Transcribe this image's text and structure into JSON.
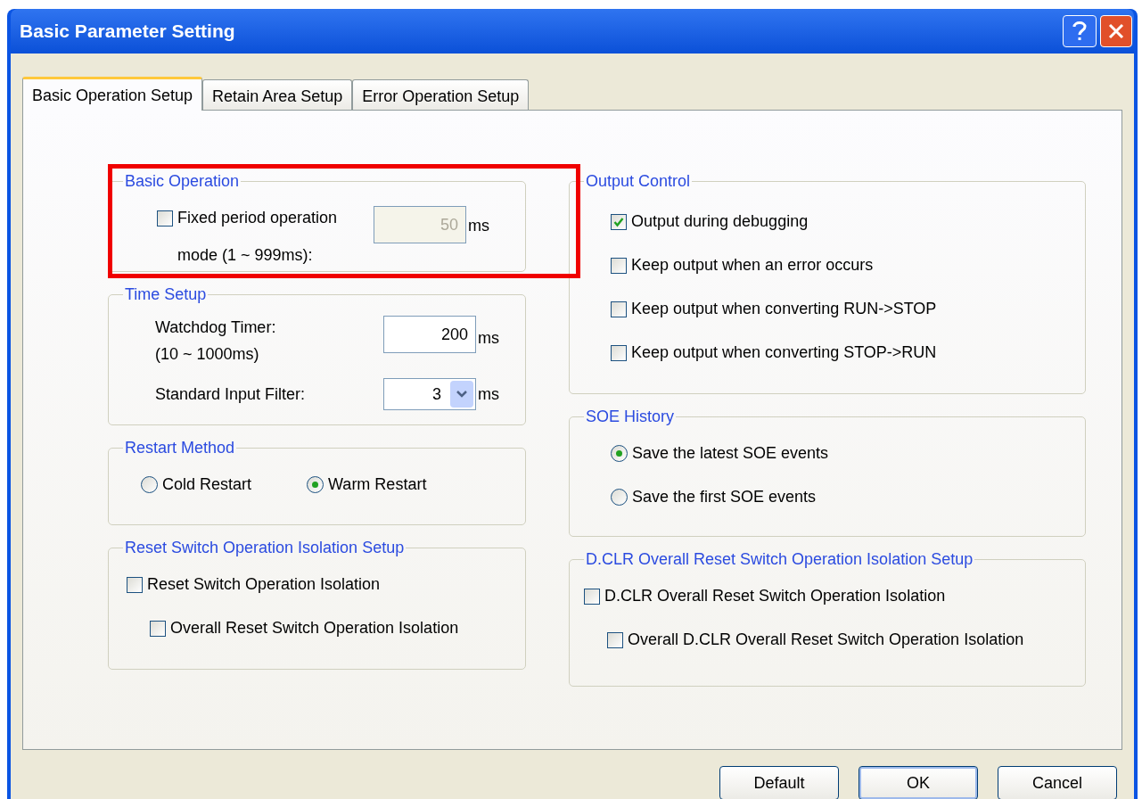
{
  "window": {
    "title": "Basic Parameter Setting"
  },
  "tabs": [
    {
      "label": "Basic Operation Setup",
      "selected": true
    },
    {
      "label": "Retain Area Setup",
      "selected": false
    },
    {
      "label": "Error Operation Setup",
      "selected": false
    }
  ],
  "left_groups": [
    {
      "title": "Basic Operation",
      "kind": "stacked",
      "items": [
        {
          "kind": "checkbox_field",
          "label": "Fixed period operation mode (1 ~ 999ms):",
          "checked": false,
          "value": "50",
          "disabled": true,
          "unit": "ms"
        }
      ]
    },
    {
      "title": "Time Setup",
      "kind": "stacked",
      "items": [
        {
          "kind": "field",
          "label": "Watchdog Timer:",
          "sublabel": "(10 ~ 1000ms)",
          "value": "200",
          "disabled": false,
          "unit": "ms"
        },
        {
          "kind": "select",
          "label": "Standard Input Filter:",
          "value": "3",
          "unit": "ms"
        }
      ]
    },
    {
      "title": "Restart Method",
      "kind": "inline",
      "items": [
        {
          "kind": "radio",
          "label": "Cold Restart",
          "selected": false
        },
        {
          "kind": "radio",
          "label": "Warm Restart",
          "selected": true
        }
      ]
    },
    {
      "title": "Reset Switch Operation Isolation Setup",
      "kind": "stacked",
      "items": [
        {
          "kind": "checkbox",
          "label": "Reset Switch Operation Isolation",
          "checked": false,
          "children": [
            {
              "kind": "checkbox",
              "label": "Overall Reset Switch Operation Isolation",
              "checked": false
            }
          ]
        }
      ]
    }
  ],
  "right_groups": [
    {
      "title": "Output Control",
      "kind": "stacked",
      "items": [
        {
          "kind": "checkbox",
          "label": "Output during debugging",
          "checked": true
        },
        {
          "kind": "checkbox",
          "label": "Keep output when an error occurs",
          "checked": false
        },
        {
          "kind": "checkbox",
          "label": "Keep output when converting RUN->STOP",
          "checked": false
        },
        {
          "kind": "checkbox",
          "label": "Keep output when converting STOP->RUN",
          "checked": false
        }
      ]
    },
    {
      "title": "SOE History",
      "kind": "stacked",
      "items": [
        {
          "kind": "radio",
          "label": "Save the latest SOE events",
          "selected": true
        },
        {
          "kind": "radio",
          "label": "Save the first SOE events",
          "selected": false
        }
      ]
    },
    {
      "title": "D.CLR Overall Reset Switch Operation Isolation Setup",
      "kind": "stacked",
      "items": [
        {
          "kind": "checkbox",
          "label": "D.CLR Overall Reset Switch Operation Isolation",
          "checked": false,
          "children": [
            {
              "kind": "checkbox",
              "label": "Overall D.CLR Overall Reset Switch Operation Isolation",
              "checked": false
            }
          ]
        }
      ]
    }
  ],
  "buttons": [
    {
      "label": "Default",
      "default": false
    },
    {
      "label": "OK",
      "default": true
    },
    {
      "label": "Cancel",
      "default": false
    }
  ]
}
